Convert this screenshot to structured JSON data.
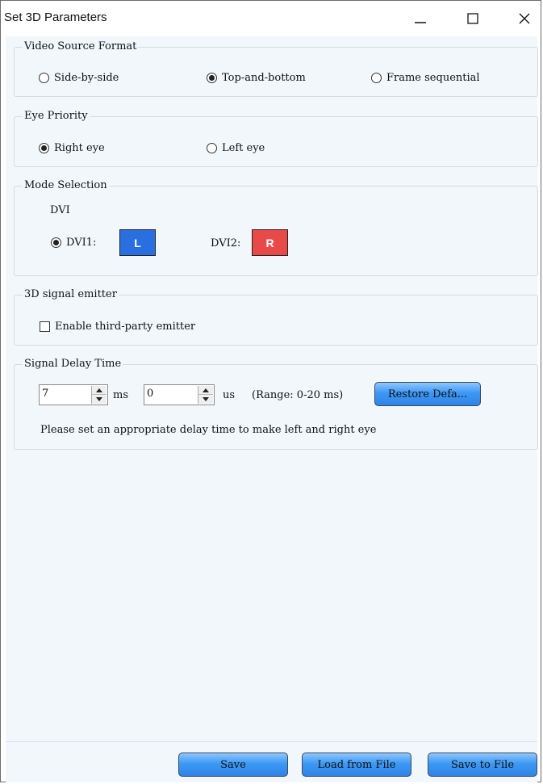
{
  "window": {
    "title": "Set 3D Parameters",
    "controls": {
      "minimize": "minimize-icon",
      "maximize": "maximize-icon",
      "close": "close-icon"
    }
  },
  "video_source": {
    "legend": "Video Source Format",
    "options": [
      "Side-by-side",
      "Top-and-bottom",
      "Frame sequential"
    ],
    "selected": "Top-and-bottom"
  },
  "eye_priority": {
    "legend": "Eye Priority",
    "options": [
      "Right eye",
      "Left eye"
    ],
    "selected": "Right eye"
  },
  "mode_selection": {
    "legend": "Mode Selection",
    "sub_label": "DVI",
    "dvi1_label": "DVI1:",
    "dvi1_button": "L",
    "dvi1_color": "#2a6fe0",
    "dvi2_label": "DVI2:",
    "dvi2_button": "R",
    "dvi2_color": "#e84a4a",
    "selected": "DVI1"
  },
  "signal_emitter": {
    "legend": "3D signal emitter",
    "checkbox_label": "Enable third-party emitter",
    "checked": false
  },
  "signal_delay": {
    "legend": "Signal Delay Time",
    "ms_value": "7",
    "ms_unit": "ms",
    "us_value": "0",
    "us_unit": "us",
    "range_text": "(Range: 0-20 ms)",
    "restore_label": "Restore Defa...",
    "hint": "Please set an appropriate delay time to make left and right eye"
  },
  "footer": {
    "save": "Save",
    "load": "Load from File",
    "save_to_file": "Save to File"
  }
}
